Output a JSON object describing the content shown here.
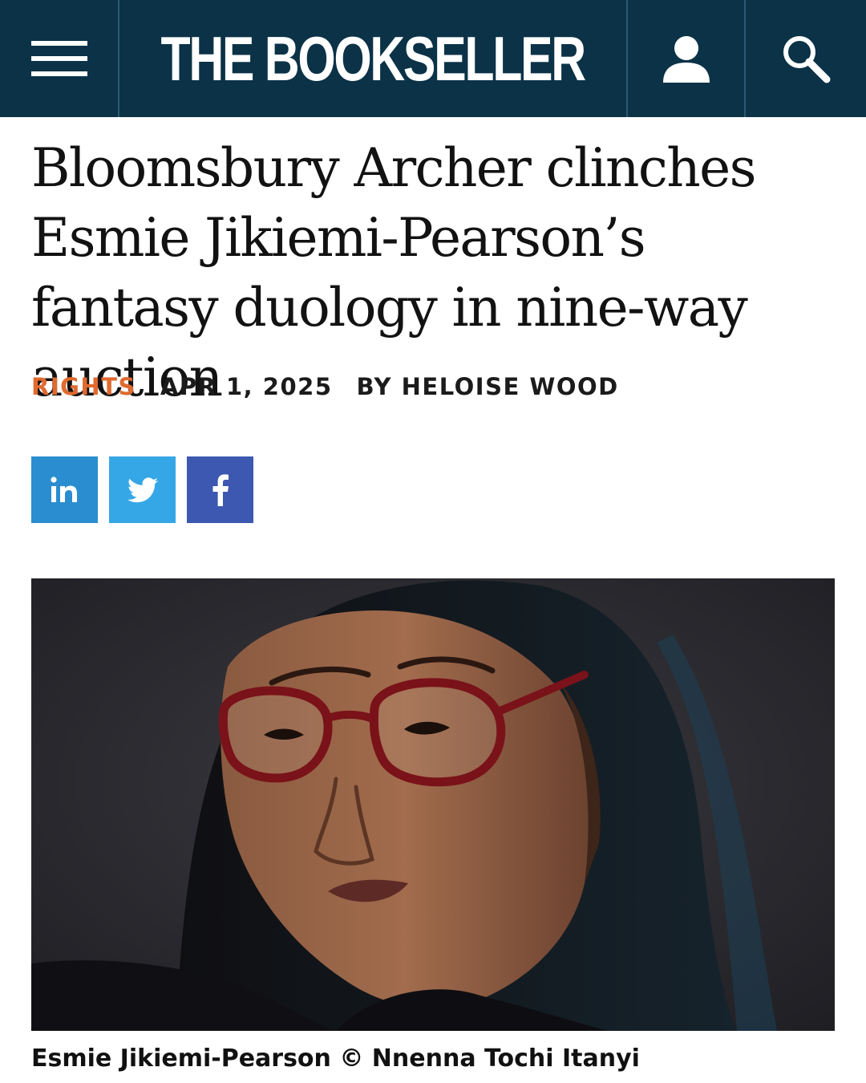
{
  "header": {
    "logo": "THE BOOKSELLER",
    "menu_icon": "hamburger-menu-icon",
    "account_icon": "user-icon",
    "search_icon": "search-icon",
    "background": "#0b3247"
  },
  "article": {
    "title": "Bloomsbury Archer clinches Esmie Jikiemi-Pearson’s fantasy duology in nine-way auction",
    "category": "RIGHTS",
    "date": "APR 1, 2025",
    "byline": "BY HELOISE WOOD",
    "category_color": "#e06a2f"
  },
  "share": {
    "linkedin_icon": "linkedin-icon",
    "twitter_icon": "twitter-icon",
    "facebook_icon": "facebook-icon",
    "linkedin_color": "#2a8dd0",
    "twitter_color": "#35a7e6",
    "facebook_color": "#3c58b0"
  },
  "image": {
    "caption": "Esmie Jikiemi-Pearson © Nnenna Tochi Itanyi"
  }
}
